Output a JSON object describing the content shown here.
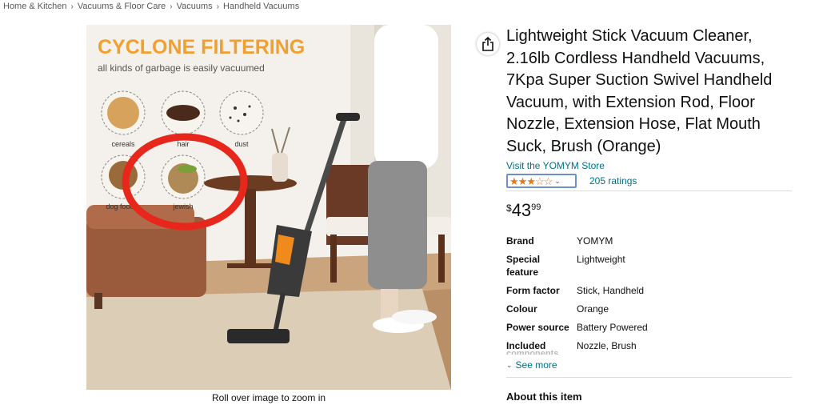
{
  "breadcrumb": [
    "Home & Kitchen",
    "Vacuums & Floor Care",
    "Vacuums",
    "Handheld Vacuums"
  ],
  "breadcrumb_separator": "›",
  "image": {
    "headline": "CYCLONE FILTERING",
    "subline": "all kinds of garbage is easily vacuumed",
    "circles": [
      "cereals",
      "hair",
      "dust",
      "dog food",
      "jewish"
    ],
    "zoom_hint": "Roll over image to zoom in"
  },
  "product": {
    "title": "Lightweight Stick Vacuum Cleaner, 2.16lb Cordless Handheld Vacuums, 7Kpa Super Suction Swivel Handheld Vacuum, with Extension Rod, Floor Nozzle, Extension Hose, Flat Mouth Suck, Brush (Orange)",
    "store": "Visit the YOMYM Store",
    "rating": 3.0,
    "ratings_count": "205 ratings",
    "price": {
      "symbol": "$",
      "whole": "43",
      "fraction": "99"
    }
  },
  "specs": [
    {
      "key": "Brand",
      "value": "YOMYM"
    },
    {
      "key": "Special feature",
      "value": "Lightweight"
    },
    {
      "key": "Form factor",
      "value": "Stick, Handheld"
    },
    {
      "key": "Colour",
      "value": "Orange"
    },
    {
      "key": "Power source",
      "value": "Battery Powered"
    },
    {
      "key": "Included",
      "value": "Nozzle, Brush"
    }
  ],
  "spec_fade_text": "components",
  "see_more": "See more",
  "about_heading": "About this item",
  "colors": {
    "link": "#007185",
    "star": "#de7921",
    "headline": "#f0a030",
    "red_circle": "#e8271c"
  }
}
